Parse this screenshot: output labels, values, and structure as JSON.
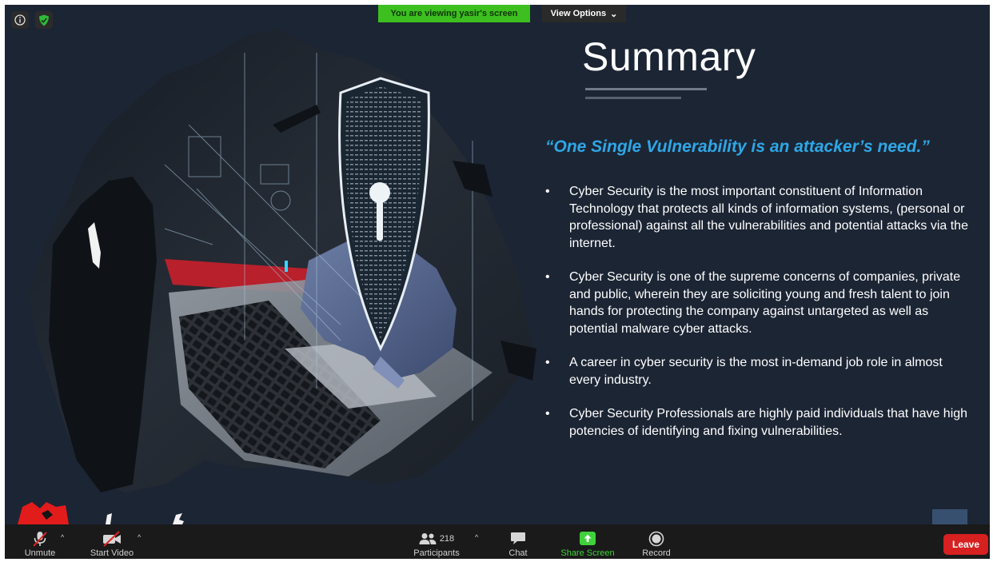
{
  "overlay": {
    "banner": "You are viewing yasir's screen",
    "view_options": "View Options",
    "view_options_caret": "⌄",
    "info_icon": "info-icon",
    "shield_icon": "shield-check-icon"
  },
  "slide": {
    "title": "Summary",
    "quote": "“One Single Vulnerability is an attacker’s need.”",
    "bullet_symbol": "•",
    "bullets": [
      "Cyber Security is the most important constituent of Information Technology that protects all kinds of information systems, (personal or professional) against all the vulnerabilities and potential attacks via the internet.",
      "Cyber Security is one of the supreme concerns of companies, private and public, wherein they are soliciting young and fresh talent to join hands for protecting the company against untargeted as well as potential malware cyber attacks.",
      "A career in cyber security is the most in-demand job role in almost every industry.",
      "Cyber Security Professionals are highly paid individuals that have high potencies of identifying and fixing vulnerabilities."
    ],
    "colors": {
      "background": "#1c2534",
      "title": "#ffffff",
      "quote": "#2ea7e6",
      "body_text": "#ffffff"
    }
  },
  "toolbar": {
    "unmute": "Unmute",
    "start_video": "Start Video",
    "participants": "Participants",
    "participants_count": "218",
    "chat": "Chat",
    "share_screen": "Share Screen",
    "record": "Record",
    "leave": "Leave",
    "caret": "^",
    "colors": {
      "background": "#1a1a1a",
      "share": "#3fd23a",
      "leave": "#d72020"
    }
  }
}
